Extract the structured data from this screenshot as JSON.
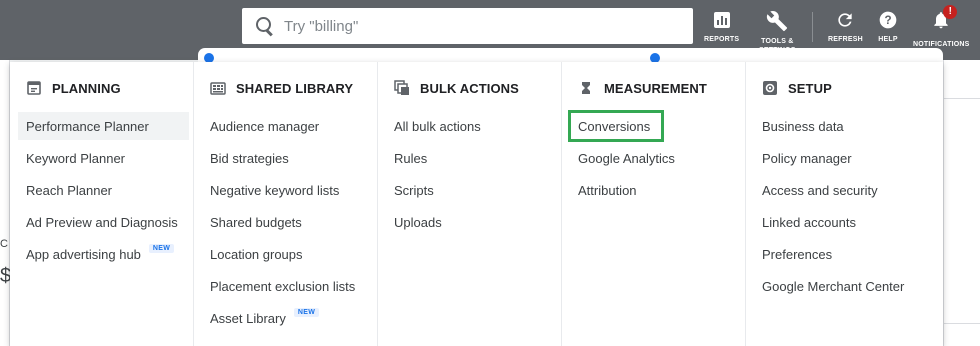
{
  "search": {
    "placeholder": "Try \"billing\""
  },
  "toolbar": {
    "reports": "REPORTS",
    "tools": "TOOLS &\nSETTINGS",
    "refresh": "REFRESH",
    "help": "HELP",
    "notifications": "NOTIFICATIONS",
    "notification_badge": "!"
  },
  "backdrop": {
    "frag1": "C",
    "frag2": "$"
  },
  "menu": {
    "planning": {
      "title": "PLANNING",
      "items": [
        "Performance Planner",
        "Keyword Planner",
        "Reach Planner",
        "Ad Preview and Diagnosis",
        "App advertising hub"
      ],
      "badge": "NEW"
    },
    "shared_library": {
      "title": "SHARED LIBRARY",
      "items": [
        "Audience manager",
        "Bid strategies",
        "Negative keyword lists",
        "Shared budgets",
        "Location groups",
        "Placement exclusion lists",
        "Asset Library"
      ],
      "badge": "NEW"
    },
    "bulk_actions": {
      "title": "BULK ACTIONS",
      "items": [
        "All bulk actions",
        "Rules",
        "Scripts",
        "Uploads"
      ]
    },
    "measurement": {
      "title": "MEASUREMENT",
      "items": [
        "Conversions",
        "Google Analytics",
        "Attribution"
      ]
    },
    "setup": {
      "title": "SETUP",
      "items": [
        "Business data",
        "Policy manager",
        "Access and security",
        "Linked accounts",
        "Preferences",
        "Google Merchant Center"
      ]
    }
  },
  "colors": {
    "highlight": "#34a853",
    "topbar": "#5f6368",
    "badge_red": "#c5221f",
    "accent": "#1a73e8"
  }
}
